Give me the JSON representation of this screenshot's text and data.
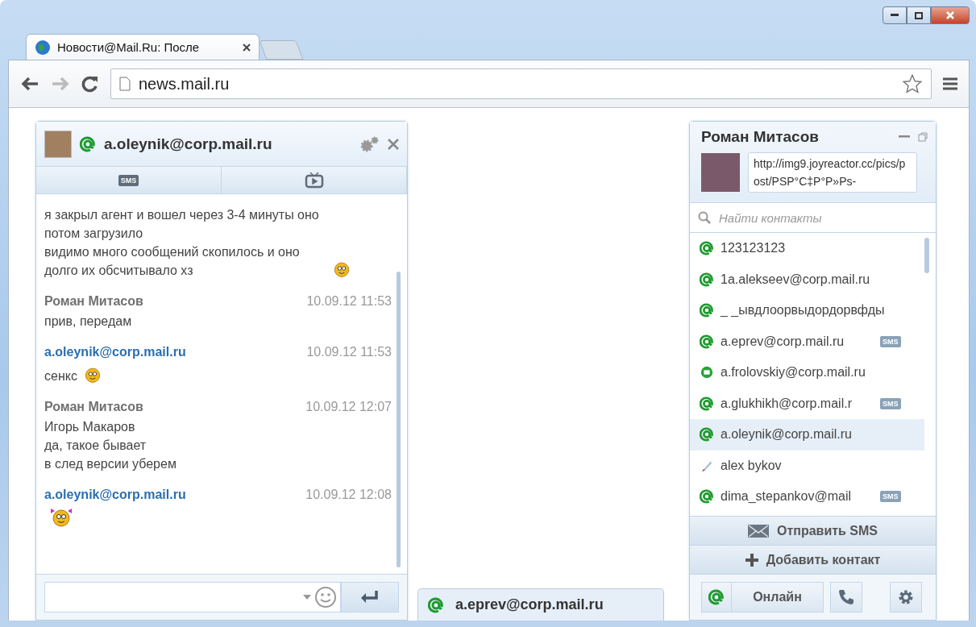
{
  "browser": {
    "tab_title": "Новости@Mail.Ru: После",
    "address": "news.mail.ru"
  },
  "chat": {
    "title": "a.oleynik@corp.mail.ru",
    "online": true,
    "tabs": [
      {
        "kind": "sms",
        "label": "SMS",
        "selected": false
      },
      {
        "kind": "video",
        "selected": false
      }
    ],
    "messages": [
      {
        "lines": [
          "я закрыл агент и вошел через 3-4 минуты оно потом загрузило",
          "видимо много сообщений скопилось и оно долго их обсчитывало хз"
        ],
        "smiley": {
          "kind": "plain"
        }
      },
      {
        "author": "Роман Митасов",
        "mine": false,
        "time": "10.09.12 11:53",
        "lines": [
          "прив, передам"
        ]
      },
      {
        "author": "a.oleynik@corp.mail.ru",
        "mine": true,
        "time": "10.09.12 11:53",
        "lines": [
          "сенкс"
        ],
        "smiley": {
          "kind": "plain"
        }
      },
      {
        "author": "Роман Митасов",
        "mine": false,
        "time": "10.09.12 12:07",
        "lines": [
          "Игорь Макаров",
          "да, такое бывает",
          "в след версии уберем"
        ]
      },
      {
        "author": "a.oleynik@corp.mail.ru",
        "mine": true,
        "time": "10.09.12 12:08",
        "smiley": {
          "kind": "bow"
        }
      }
    ]
  },
  "minimized_chat": {
    "title": "a.eprev@corp.mail.ru",
    "online": true
  },
  "contacts": {
    "owner": "Роман Митасов",
    "status_text": "http://img9.joyreactor.cc/pics/post/PSP°C‡P°P»Ps-",
    "search": {
      "placeholder": "Найти контакты"
    },
    "items": [
      {
        "kind": "online",
        "name": "123123123",
        "selected": false
      },
      {
        "kind": "online",
        "name": "1a.alekseev@corp.mail.ru",
        "selected": false
      },
      {
        "kind": "online",
        "name": "_ _ывдлоорвыдордорвфды",
        "selected": false
      },
      {
        "kind": "online",
        "name": "a.eprev@corp.mail.ru",
        "sms": "SMS",
        "selected": false
      },
      {
        "kind": "away",
        "name": "a.frolovskiy@corp.mail.ru",
        "selected": false
      },
      {
        "kind": "online",
        "name": "a.glukhikh@corp.mail.r",
        "sms": "SMS",
        "selected": false
      },
      {
        "kind": "online",
        "name": "a.oleynik@corp.mail.ru",
        "selected": true
      },
      {
        "kind": "pencil",
        "name": "alex bykov",
        "selected": false
      },
      {
        "kind": "online",
        "name": "dima_stepankov@mail",
        "sms": "SMS",
        "selected": false
      }
    ],
    "actions": [
      {
        "kind": "sms",
        "label": "Отправить SMS"
      },
      {
        "kind": "add",
        "label": "Добавить контакт"
      }
    ],
    "presence": {
      "online": true,
      "label": "Онлайн"
    }
  }
}
